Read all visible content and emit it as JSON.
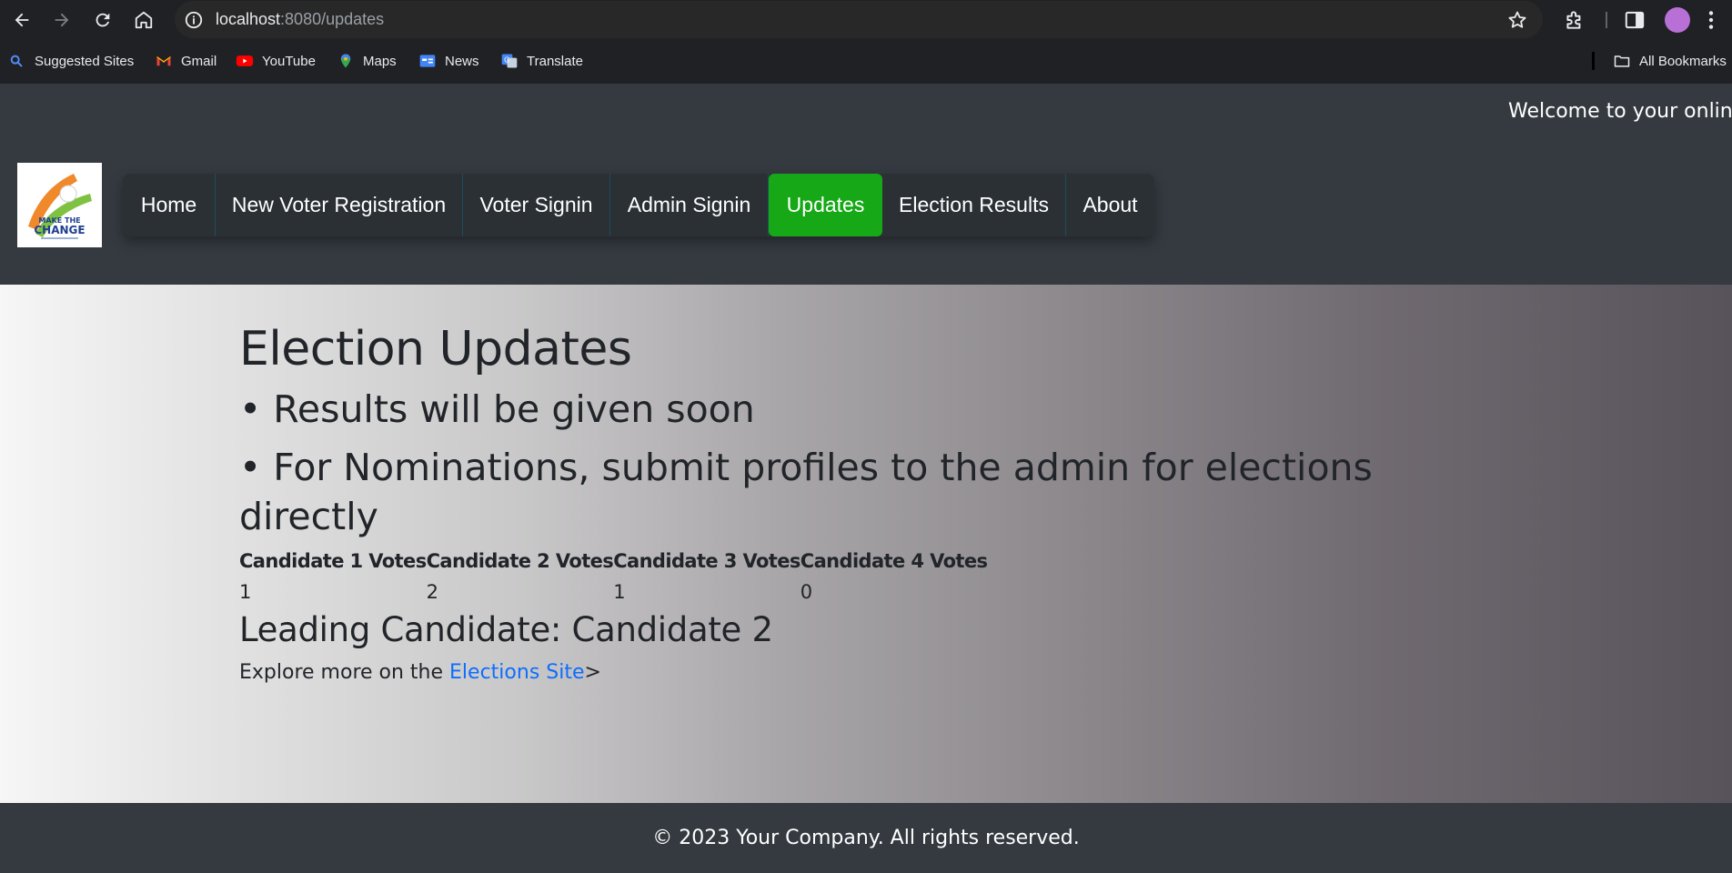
{
  "browser": {
    "url_host": "localhost",
    "url_rest": ":8080/updates",
    "bookmarks": [
      {
        "label": "Suggested Sites",
        "icon": "search-icon"
      },
      {
        "label": "Gmail",
        "icon": "gmail-icon"
      },
      {
        "label": "YouTube",
        "icon": "youtube-icon"
      },
      {
        "label": "Maps",
        "icon": "maps-icon"
      },
      {
        "label": "News",
        "icon": "news-icon"
      },
      {
        "label": "Translate",
        "icon": "translate-icon"
      }
    ],
    "all_bookmarks": "All Bookmarks"
  },
  "header": {
    "marquee": "Welcome to your online voting",
    "logo": {
      "line1": "MAKE THE",
      "line2": "CHANGE"
    },
    "nav": [
      {
        "label": "Home",
        "active": false
      },
      {
        "label": "New Voter Registration",
        "active": false
      },
      {
        "label": "Voter Signin",
        "active": false
      },
      {
        "label": "Admin Signin",
        "active": false
      },
      {
        "label": "Updates",
        "active": true
      },
      {
        "label": "Election Results",
        "active": false
      },
      {
        "label": "About",
        "active": false
      }
    ]
  },
  "main": {
    "title": "Election Updates",
    "bullets": [
      "• Results will be given soon",
      "• For Nominations, submit profiles to the admin for elections directly"
    ],
    "votes_table": {
      "headers": [
        "Candidate 1 Votes",
        "Candidate 2 Votes",
        "Candidate 3 Votes",
        "Candidate 4 Votes"
      ],
      "values": [
        "1",
        "2",
        "1",
        "0"
      ]
    },
    "leading": "Leading Candidate: Candidate 2",
    "explore_prefix": "Explore more on the ",
    "explore_link": "Elections Site",
    "explore_suffix": ">"
  },
  "footer": {
    "text": "© 2023 Your Company. All rights reserved."
  },
  "colors": {
    "header_bg": "#343a40",
    "active_nav": "#16a816",
    "link": "#0d6efd"
  }
}
